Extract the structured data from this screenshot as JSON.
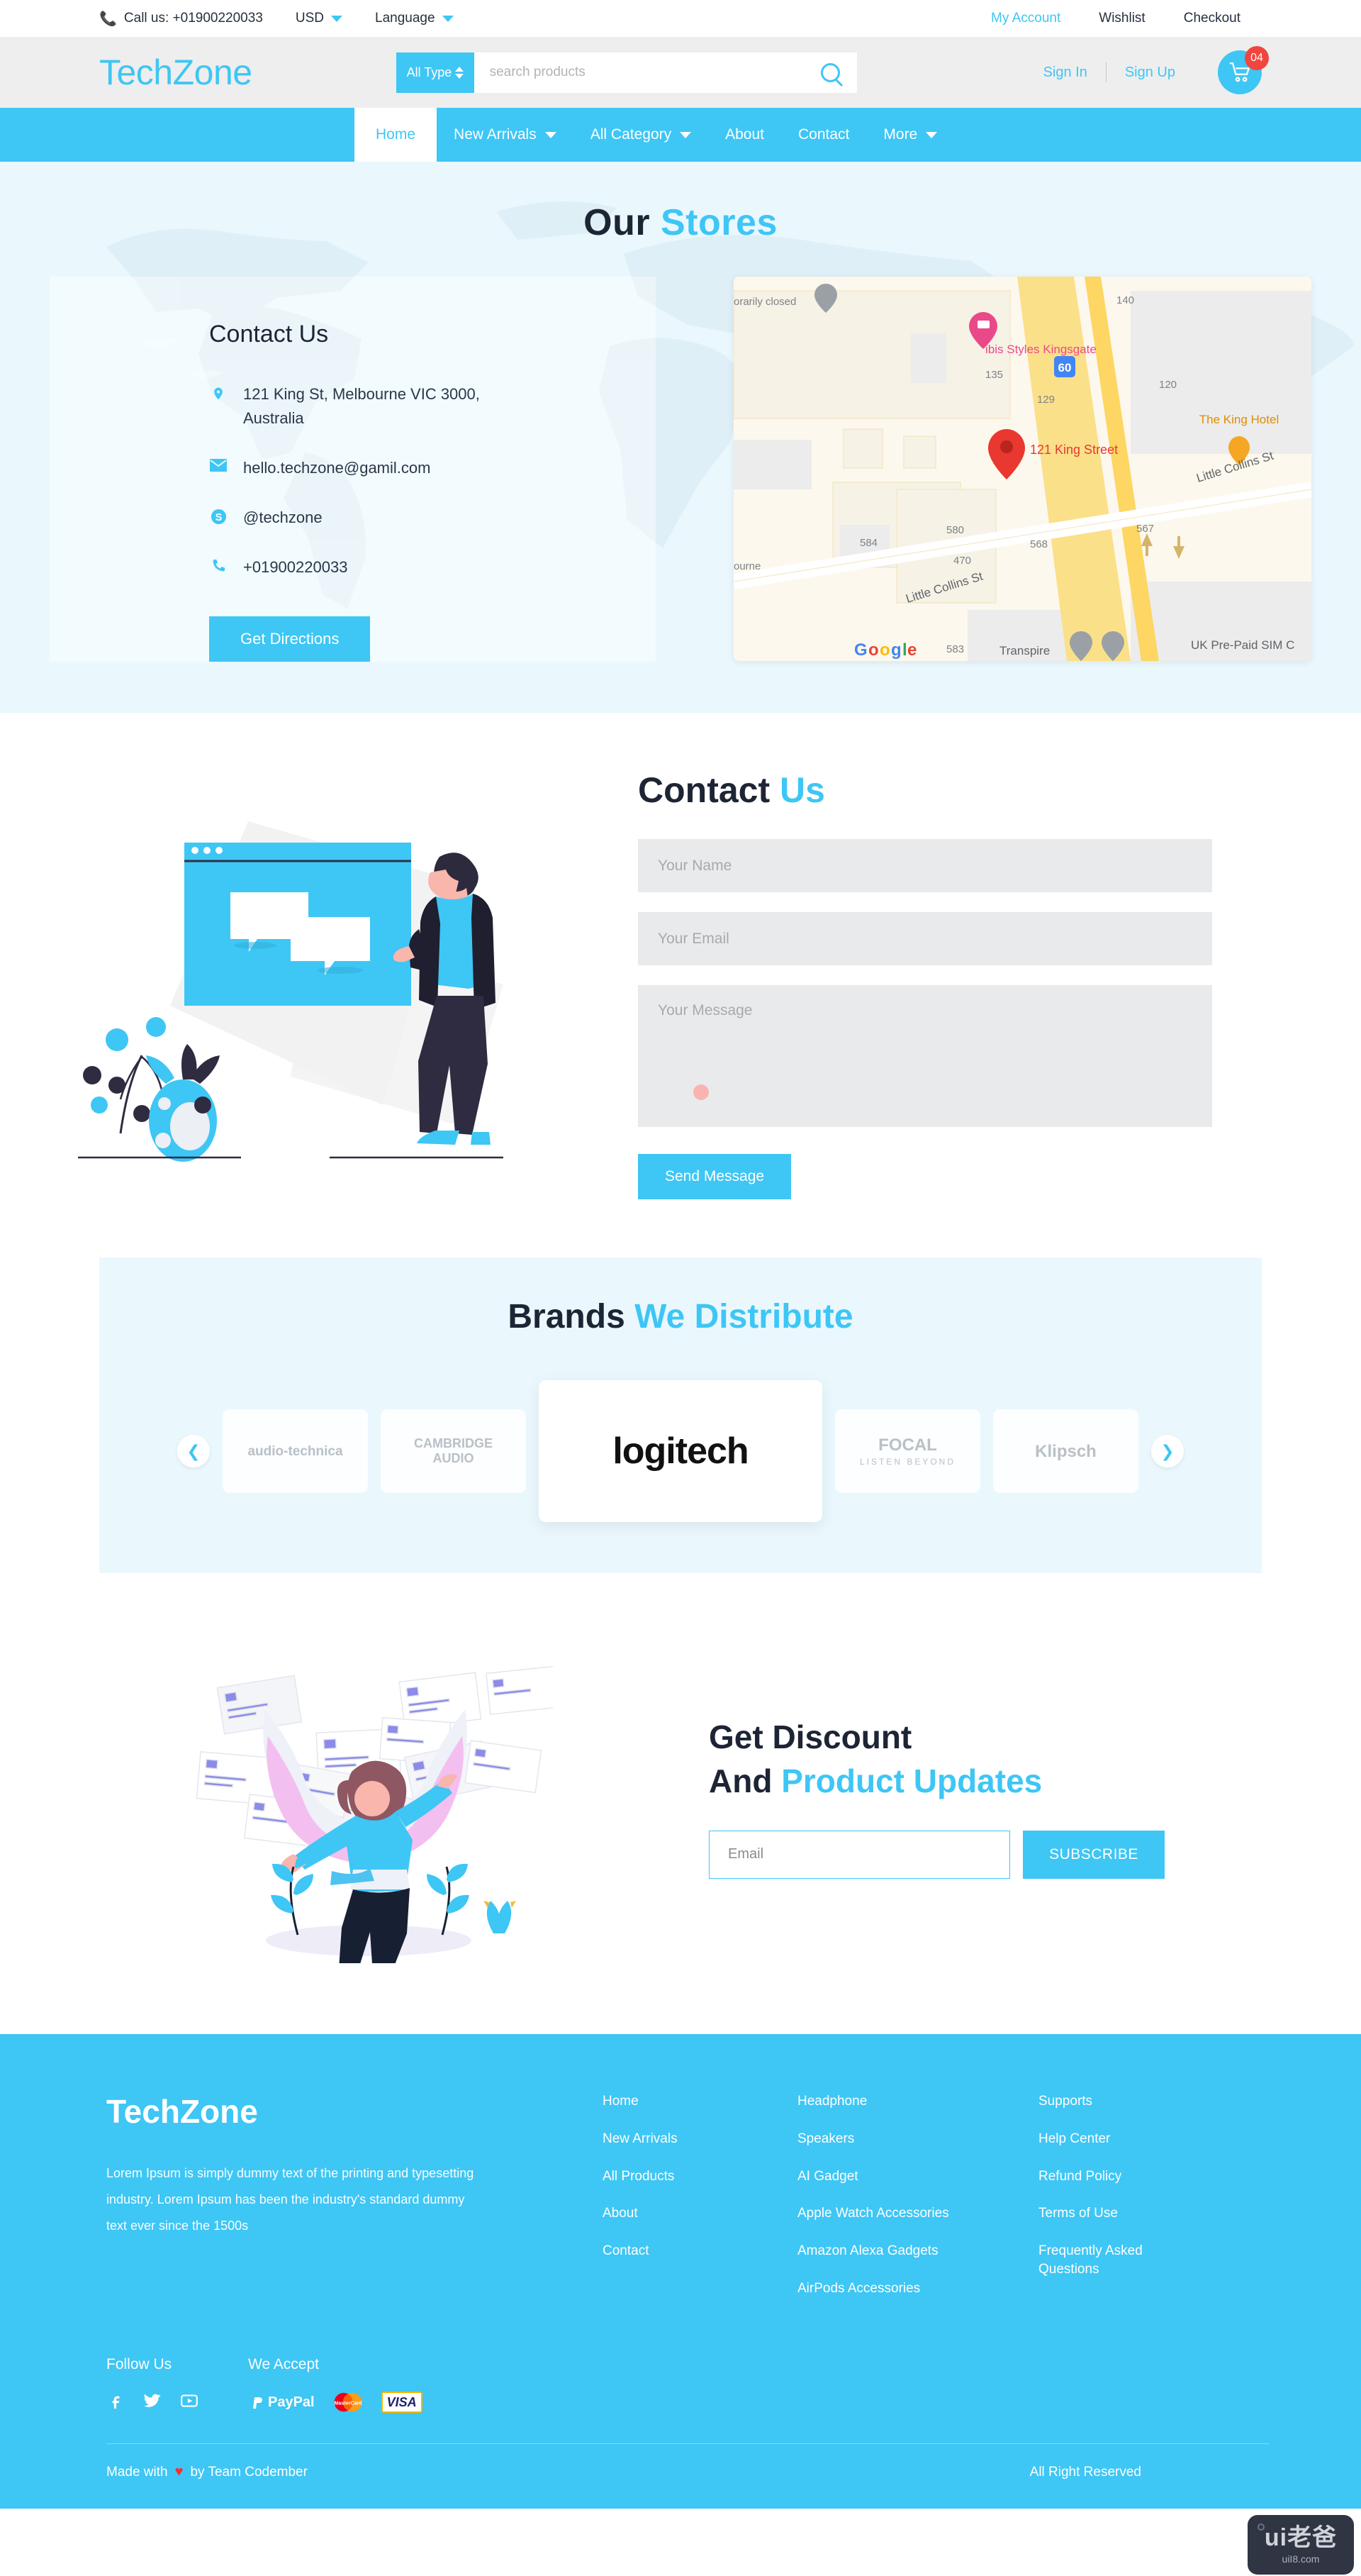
{
  "colors": {
    "accent": "#3ec6f5",
    "pale_bg": "#eaf8fe",
    "header_bg": "#eeeeee",
    "field_bg": "#e9eaec",
    "badge_red": "#f0463e",
    "heart_red": "#ff2d2d"
  },
  "topbar": {
    "phone_icon": "phone-icon",
    "call_us": "Call us: +01900220033",
    "currency": "USD",
    "language": "Language",
    "my_account": "My Account",
    "wishlist": "Wishlist",
    "checkout": "Checkout"
  },
  "header": {
    "logo": "TechZone",
    "search": {
      "type_label": "All Type",
      "placeholder": "search products",
      "value": "",
      "search_icon": "search-icon"
    },
    "sign_in": "Sign In",
    "sign_up": "Sign Up",
    "cart_icon": "shopping-cart-icon",
    "cart_count": "04"
  },
  "nav": {
    "items": [
      {
        "label": "Home",
        "active": true,
        "caret": false
      },
      {
        "label": "New Arrivals",
        "active": false,
        "caret": true
      },
      {
        "label": "All Category",
        "active": false,
        "caret": true
      },
      {
        "label": "About",
        "active": false,
        "caret": false
      },
      {
        "label": "Contact",
        "active": false,
        "caret": false
      },
      {
        "label": "More",
        "active": false,
        "caret": true
      }
    ]
  },
  "stores": {
    "title_black": "Our",
    "title_blue": "Stores",
    "card_title": "Contact Us",
    "address": "121 King St, Melbourne VIC 3000, Australia",
    "email": "hello.techzone@gamil.com",
    "skype": "@techzone",
    "phone": "+01900220033",
    "directions_button": "Get Directions",
    "map": {
      "provider": "Google",
      "pin_label": "121 King Street",
      "labels": [
        "orarily closed",
        "ibis Styles Kingsgate",
        "The King Hotel",
        "Little Collins St",
        "Little Collins St",
        "UK Pre-Paid SIM C",
        "Transpire",
        "ourne"
      ],
      "numbers": [
        "140",
        "135",
        "129",
        "120",
        "60",
        "584",
        "580",
        "568",
        "567",
        "470",
        "583"
      ]
    }
  },
  "contact": {
    "title_black": "Contact",
    "title_blue": "Us",
    "name_placeholder": "Your Name",
    "name_value": "",
    "email_placeholder": "Your Email",
    "email_value": "",
    "message_placeholder": "Your Message",
    "message_value": "",
    "send_button": "Send Message",
    "illustration": "chat-bubbles-window-man-illustration"
  },
  "brands": {
    "title_black": "Brands",
    "title_blue": "We Distribute",
    "prev_icon": "chevron-left-icon",
    "next_icon": "chevron-right-icon",
    "items": [
      {
        "name": "audio-technica",
        "sub": ""
      },
      {
        "name": "CAMBRIDGE",
        "sub": "AUDIO"
      },
      {
        "name": "logitech",
        "sub": "",
        "featured": true
      },
      {
        "name": "FOCAL",
        "sub": "LISTEN BEYOND"
      },
      {
        "name": "Klipsch",
        "sub": ""
      }
    ]
  },
  "newsletter": {
    "line1_black": "Get Discount",
    "line2_black": "And",
    "line2_blue": "Product Updates",
    "email_placeholder": "Email",
    "email_value": "",
    "subscribe_button": "SUBSCRIBE",
    "illustration": "angel-with-envelopes-illustration"
  },
  "footer": {
    "brand": "TechZone",
    "description": "Lorem Ipsum is simply dummy text of the printing and typesetting industry. Lorem Ipsum has been the industry's standard dummy text ever since the 1500s",
    "col1": [
      "Home",
      "New Arrivals",
      "All Products",
      "About",
      "Contact"
    ],
    "col2": [
      "Headphone",
      "Speakers",
      "AI Gadget",
      "Apple Watch Accessories",
      "Amazon Alexa Gadgets",
      "AirPods Accessories"
    ],
    "col3": [
      "Supports",
      "Help Center",
      "Refund Policy",
      "Terms of Use",
      "Frequently Asked Questions"
    ],
    "follow_us_label": "Follow Us",
    "social": [
      "facebook-icon",
      "twitter-icon",
      "youtube-icon"
    ],
    "we_accept_label": "We Accept",
    "payments": [
      "PayPal",
      "MasterCard",
      "VISA"
    ],
    "credit_prefix": "Made with",
    "credit_heart": "♥",
    "credit_suffix": "by Team Codember",
    "rights": "All Right Reserved"
  },
  "watermark": {
    "top": "ui老爸",
    "bottom": "uiI8.com"
  }
}
